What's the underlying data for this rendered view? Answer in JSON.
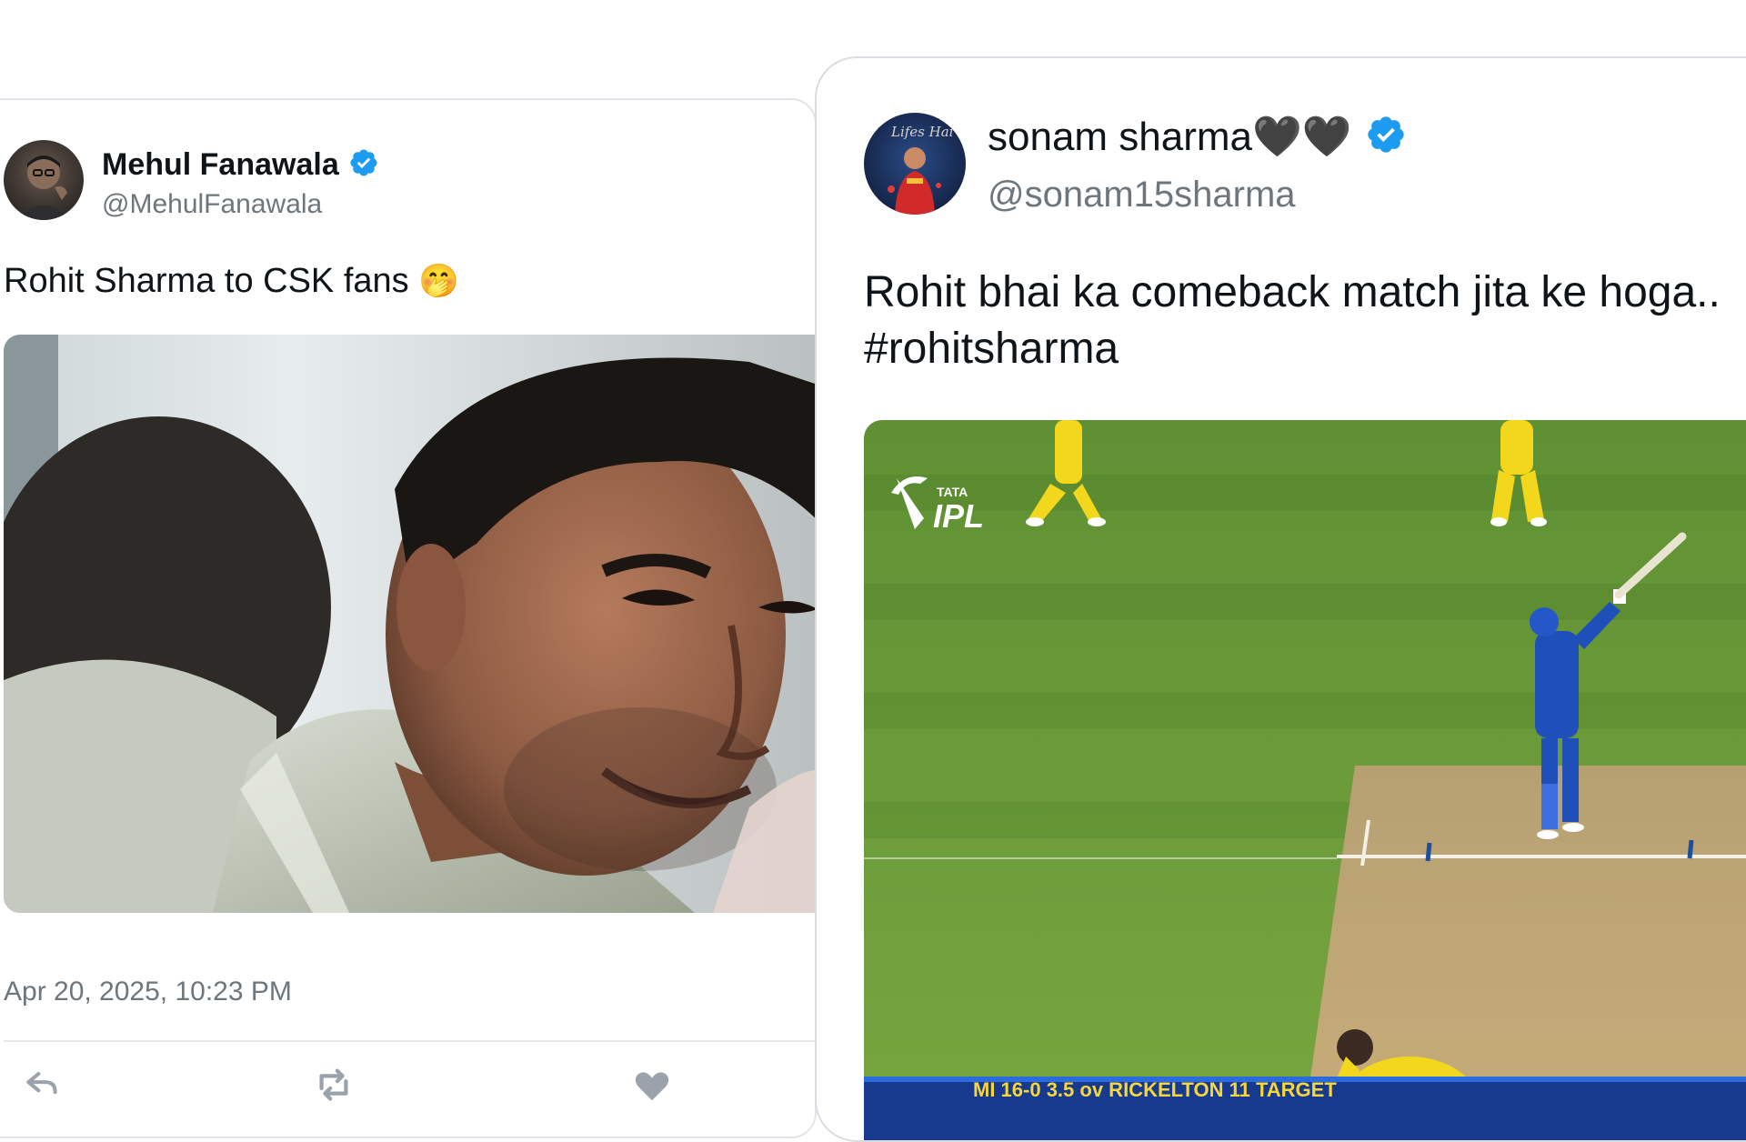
{
  "tweets": [
    {
      "author_name": "Mehul Fanawala",
      "handle": "@MehulFanawala",
      "text": "Rohit Sharma to CSK fans",
      "emoji": "🤭",
      "timestamp": "Apr 20, 2025, 10:23 PM",
      "verified": true
    },
    {
      "author_name": "sonam sharma🖤🖤",
      "handle": "@sonam15sharma",
      "text_line1": "Rohit bhai ka comeback match jita ke hoga..",
      "text_line2": "#rohitsharma",
      "verified": true,
      "media": {
        "broadcast_logo_top": "TATA",
        "broadcast_logo_main": "IPL",
        "score_bar": "MI 16-0 3.5 ov  RICKELTON 11  TARGET"
      }
    }
  ],
  "colors": {
    "verified_blue": "#1d9bf0",
    "handle_gray": "#6e767d",
    "text_dark": "#0f1419",
    "pitch_green": "#6f9a3a",
    "csk_yellow": "#f2d71c",
    "mi_blue": "#1f4fb8"
  },
  "icons": [
    "reply-icon",
    "retweet-icon",
    "like-icon",
    "verified-badge-icon"
  ]
}
